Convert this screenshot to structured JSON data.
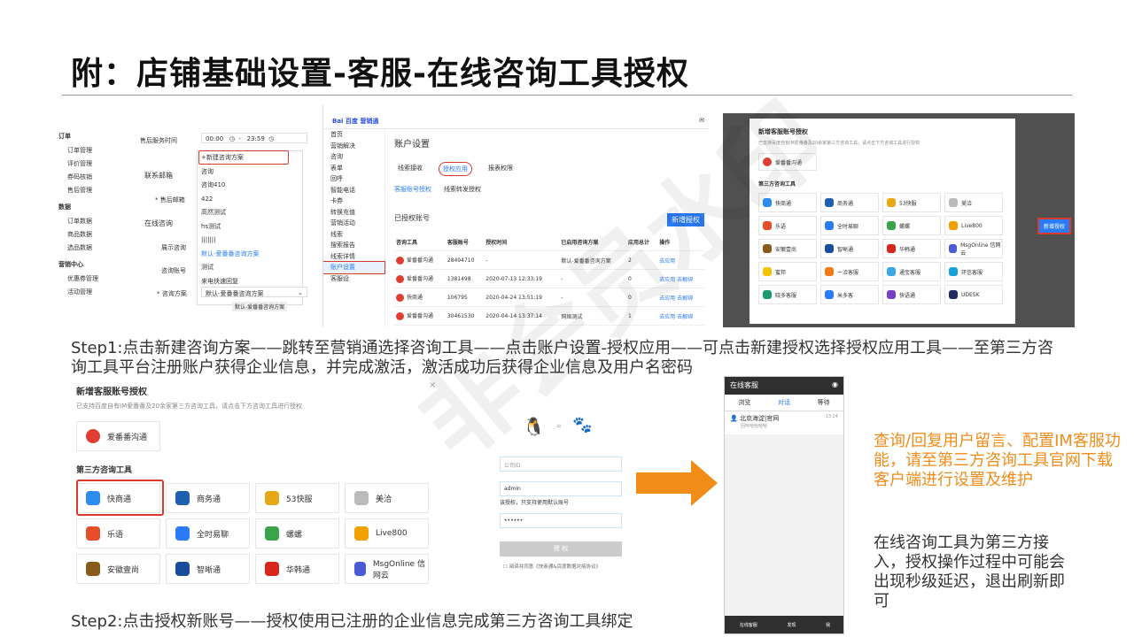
{
  "title": "附：店铺基础设置-客服-在线咨询工具授权",
  "panel1": {
    "menu": [
      {
        "group": "订单",
        "items": [
          "订单管理",
          "评价管理",
          "券码核销",
          "售后管理"
        ]
      },
      {
        "group": "数据",
        "items": [
          "订单数据",
          "商品数据",
          "选品数据"
        ]
      },
      {
        "group": "营销中心",
        "items": [
          "优惠券管理",
          "活动管理"
        ]
      }
    ],
    "after_sale_label": "售后服务时间",
    "time_start": "00:00",
    "time_end": "23:59",
    "contact_email_label": "联系邮箱",
    "after_sale_email_label": "* 售后邮箱",
    "online_consult_label": "在线咨询",
    "show_consult_label": "展示咨询",
    "consult_account_label": "咨询账号",
    "consult_plan_label": "* 咨询方案",
    "plan_value": "默认-爱番番咨询方案",
    "dropdown": [
      "+新建咨询方案",
      "咨询",
      "咨询410",
      "422",
      "高然测试",
      "hs测试",
      "|||||||",
      "默认-爱番番咨询方案",
      "测试",
      "来电快速回复"
    ]
  },
  "panel2": {
    "brand": "Bai 百度 营销通",
    "page_title": "账户设置",
    "side": [
      "首页",
      "营销解决",
      "咨询",
      "表单",
      "回呼",
      "智能电话",
      "卡券",
      "转换充值",
      "营销活动",
      "线索",
      "搜索报告",
      "线索详情",
      "账户设置",
      "客服设"
    ],
    "tabs": [
      "线索接收",
      "授权应用",
      "报表权限"
    ],
    "subtabs": [
      "客服账号授权",
      "线索转发授权"
    ],
    "authorized": "已授权账号",
    "new_btn": "新增授权",
    "headers": [
      "咨询工具",
      "客服账号",
      "授权时间",
      "已启用咨询方案",
      "应用总计",
      "操作"
    ],
    "rows": [
      [
        "爱番番沟通",
        "28494710",
        "-",
        "默认-爱番番咨询方案",
        "2",
        "去应用"
      ],
      [
        "爱番番沟通",
        "1381498",
        "2020-07-13 12:33:19",
        "-",
        "0",
        "去应用  去解绑"
      ],
      [
        "快商通",
        "106795",
        "2020-04-24 13:51:19",
        "-",
        "0",
        "去应用  去解绑"
      ],
      [
        "爱番番沟通",
        "30461530",
        "2020-04-14 13:37:14",
        "网络测试",
        "1",
        "去应用  去解绑"
      ]
    ]
  },
  "panel3": {
    "modal_title": "新增客服账号授权",
    "desc": "已支持百度自有IM爱番番及20余家第三方咨询工具，请点击下方咨询工具进行授权",
    "aifanfan": "爱番番沟通",
    "third": "第三方咨询工具",
    "tools": [
      "快商通",
      "商务通",
      "53快服",
      "美洽",
      "乐语",
      "全时易聊",
      "螺螺",
      "Live800",
      "安徽壹尚",
      "智晰通",
      "华韩通",
      "MsgOnline 信网云",
      "蜜邦",
      "一洽客服",
      "通宝客服",
      "环信客服",
      "晓多客服",
      "米多客",
      "快语通",
      "UDESK"
    ],
    "right_btn": "新增授权"
  },
  "step1": "Step1:点击新建咨询方案——跳转至营销通选择咨询工具——点击账户设置-授权应用——可点击新建授权选择授权应用工具——至第三方咨询工具平台注册账户获得企业信息，并完成激活，激活成功后获得企业信息及用户名密码",
  "panel4": {
    "modal_title": "新增客服账号授权",
    "desc": "已支持百度自有IM爱番番及20余家第三方咨询工具，请点击下方咨询工具进行授权",
    "aifanfan": "爱番番沟通",
    "third": "第三方咨询工具",
    "tools": [
      "快商通",
      "商务通",
      "53快服",
      "美洽",
      "乐语",
      "全时易聊",
      "螺螺",
      "Live800",
      "安徽壹尚",
      "智晰通",
      "华韩通",
      "MsgOnline 信网云"
    ],
    "close": "×"
  },
  "panel5": {
    "id_placeholder": "公司ID",
    "user": "admin",
    "note": "该授权，只支持使用默认账号",
    "pwd": "••••••",
    "auth_btn": "授 权",
    "agree": "阅读并同意《快商通&百度数据对接协议》"
  },
  "panel6": {
    "header": "在线客服",
    "tabs": [
      "浏览",
      "对话",
      "等待"
    ],
    "item_title": "北京海淀|官网",
    "item_sub": "回呼哈哈哈哈",
    "item_time": "13:24",
    "foot": [
      "在线客服",
      "发现",
      "我"
    ]
  },
  "orange_note": "查询/回复用户留言、配置IM客服功能，请至第三方咨询工具官网下载客户端进行设置及维护",
  "grey_note": "在线咨询工具为第三方接入，授权操作过程中可能会出现秒级延迟，退出刷新即可",
  "step2": "Step2:点击授权新账号——授权使用已注册的企业信息完成第三方咨询工具绑定",
  "watermark": "非会员水印",
  "colors": {
    "accent": "#f08c1a",
    "highlight": "#d93a2b",
    "blue": "#2a7cf6"
  }
}
